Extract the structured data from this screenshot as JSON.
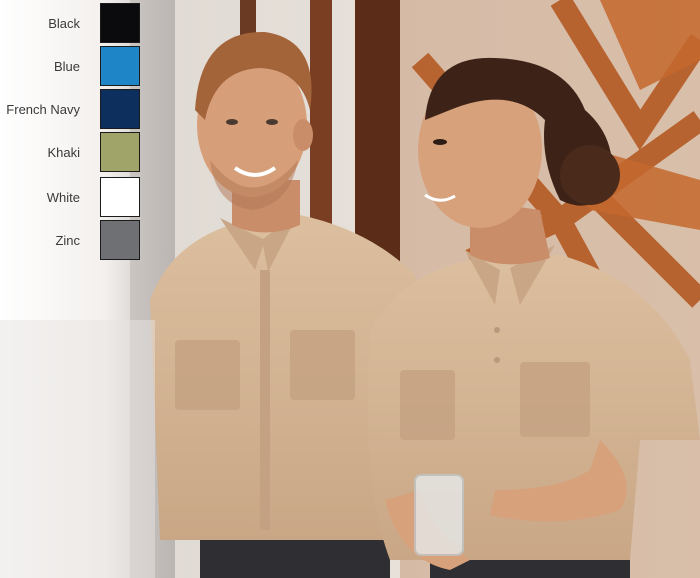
{
  "swatches": [
    {
      "label": "Black",
      "color": "#0b0b0d"
    },
    {
      "label": "Blue",
      "color": "#1e86c6"
    },
    {
      "label": "French Navy",
      "color": "#0d2f5e"
    },
    {
      "label": "Khaki",
      "color": "#a0a468"
    },
    {
      "label": "White",
      "color": "#ffffff"
    },
    {
      "label": "Zinc",
      "color": "#6e7073"
    }
  ],
  "photo": {
    "subject": "two people in beige short-sleeve shirts",
    "colors": {
      "background_wall": "#efe9e2",
      "wood_frame": "#7a3e22",
      "rust_sculpture": "#b45a24",
      "shirt": "#d8b99a",
      "shirt_shadow": "#b8977a",
      "skin": "#d7a17c",
      "hair_man": "#a4643a",
      "hair_woman": "#3d2317",
      "apron": "#2e2e33"
    }
  }
}
